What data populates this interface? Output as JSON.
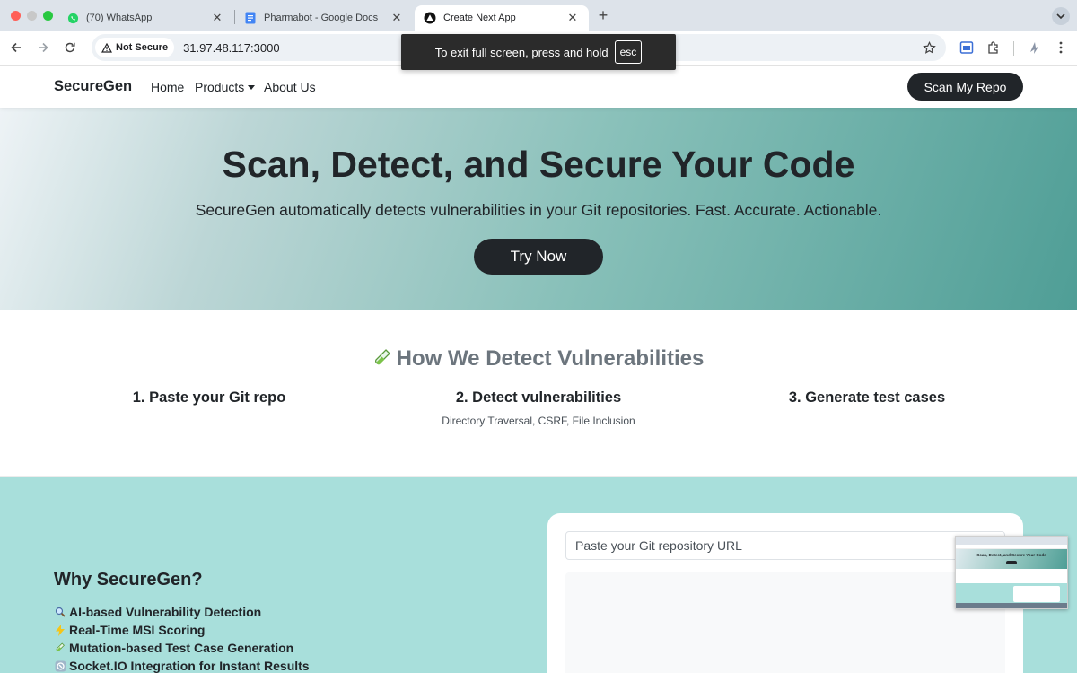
{
  "browser": {
    "tabs": [
      {
        "title": "(70) WhatsApp",
        "icon": "whatsapp-icon"
      },
      {
        "title": "Pharmabot - Google Docs",
        "icon": "google-docs-icon"
      },
      {
        "title": "Create Next App",
        "icon": "nextjs-icon",
        "active": true
      }
    ],
    "security_label": "Not Secure",
    "url": "31.97.48.117:3000",
    "fullscreen_toast": {
      "text": "To exit full screen, press and hold",
      "key": "esc"
    }
  },
  "site": {
    "brand": "SecureGen",
    "nav": {
      "home": "Home",
      "products": "Products",
      "about": "About Us"
    },
    "cta": "Scan My Repo"
  },
  "hero": {
    "title": "Scan, Detect, and Secure Your Code",
    "subtitle": "SecureGen automatically detects vulnerabilities in your Git repositories. Fast. Accurate. Actionable.",
    "button": "Try Now"
  },
  "how": {
    "title": "How We Detect Vulnerabilities",
    "steps": [
      {
        "title": "1. Paste your Git repo",
        "desc": ""
      },
      {
        "title": "2. Detect vulnerabilities",
        "desc": "Directory Traversal, CSRF, File Inclusion"
      },
      {
        "title": "3. Generate test cases",
        "desc": ""
      }
    ]
  },
  "why": {
    "title": "Why SecureGen?",
    "items": [
      {
        "text": "AI-based Vulnerability Detection",
        "icon": "magnifier-icon"
      },
      {
        "text": "Real-Time MSI Scoring",
        "icon": "lightning-icon"
      },
      {
        "text": "Mutation-based Test Case Generation",
        "icon": "test-tube-icon"
      },
      {
        "text": "Socket.IO Integration for Instant Results",
        "icon": "socket-icon"
      }
    ],
    "repo_placeholder": "Paste your Git repository URL"
  },
  "thumbnail": {
    "title": "Scan, Detect, and Secure Your Code"
  },
  "colors": {
    "hero_start": "#eef3f6",
    "hero_end": "#4f9e96",
    "why_bg": "#a8dfdb",
    "dark_button": "#212529"
  }
}
